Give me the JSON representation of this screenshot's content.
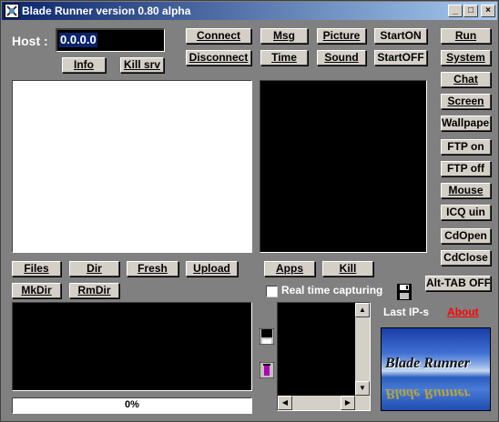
{
  "window": {
    "title": "Blade Runner version 0.80 alpha",
    "minimize": "_",
    "maximize": "□",
    "close": "×"
  },
  "host": {
    "label": "Host :",
    "value": "0.0.0.0"
  },
  "buttons": {
    "info": "Info",
    "kill_srv": "Kill srv",
    "connect": "Connect",
    "disconnect": "Disconnect",
    "msg": "Msg",
    "time": "Time",
    "picture": "Picture",
    "sound": "Sound",
    "start_on": "StartON",
    "start_off": "StartOFF",
    "files": "Files",
    "dir": "Dir",
    "fresh": "Fresh",
    "upload": "Upload",
    "mkdir": "MkDir",
    "rmdir": "RmDir",
    "apps": "Apps",
    "kill": "Kill",
    "alt_tab_off": "Alt-TAB OFF"
  },
  "side_buttons": [
    "Run",
    "System",
    "Chat",
    "Screen",
    "Wallpaper",
    "FTP on",
    "FTP off",
    "Mouse",
    "ICQ uin",
    "CdOpen",
    "CdClose"
  ],
  "realtime": {
    "label": "Real time capturing",
    "checked": false
  },
  "last_ips": "Last  IP-s",
  "about": "About",
  "progress": {
    "text": "0%",
    "value": 0
  },
  "banner": {
    "text": "Blade Runner"
  },
  "colors": {
    "face": "#d4d0c8",
    "background": "#808080",
    "about_link": "#ff0000",
    "title_start": "#0a246a",
    "title_end": "#a6caf0"
  }
}
